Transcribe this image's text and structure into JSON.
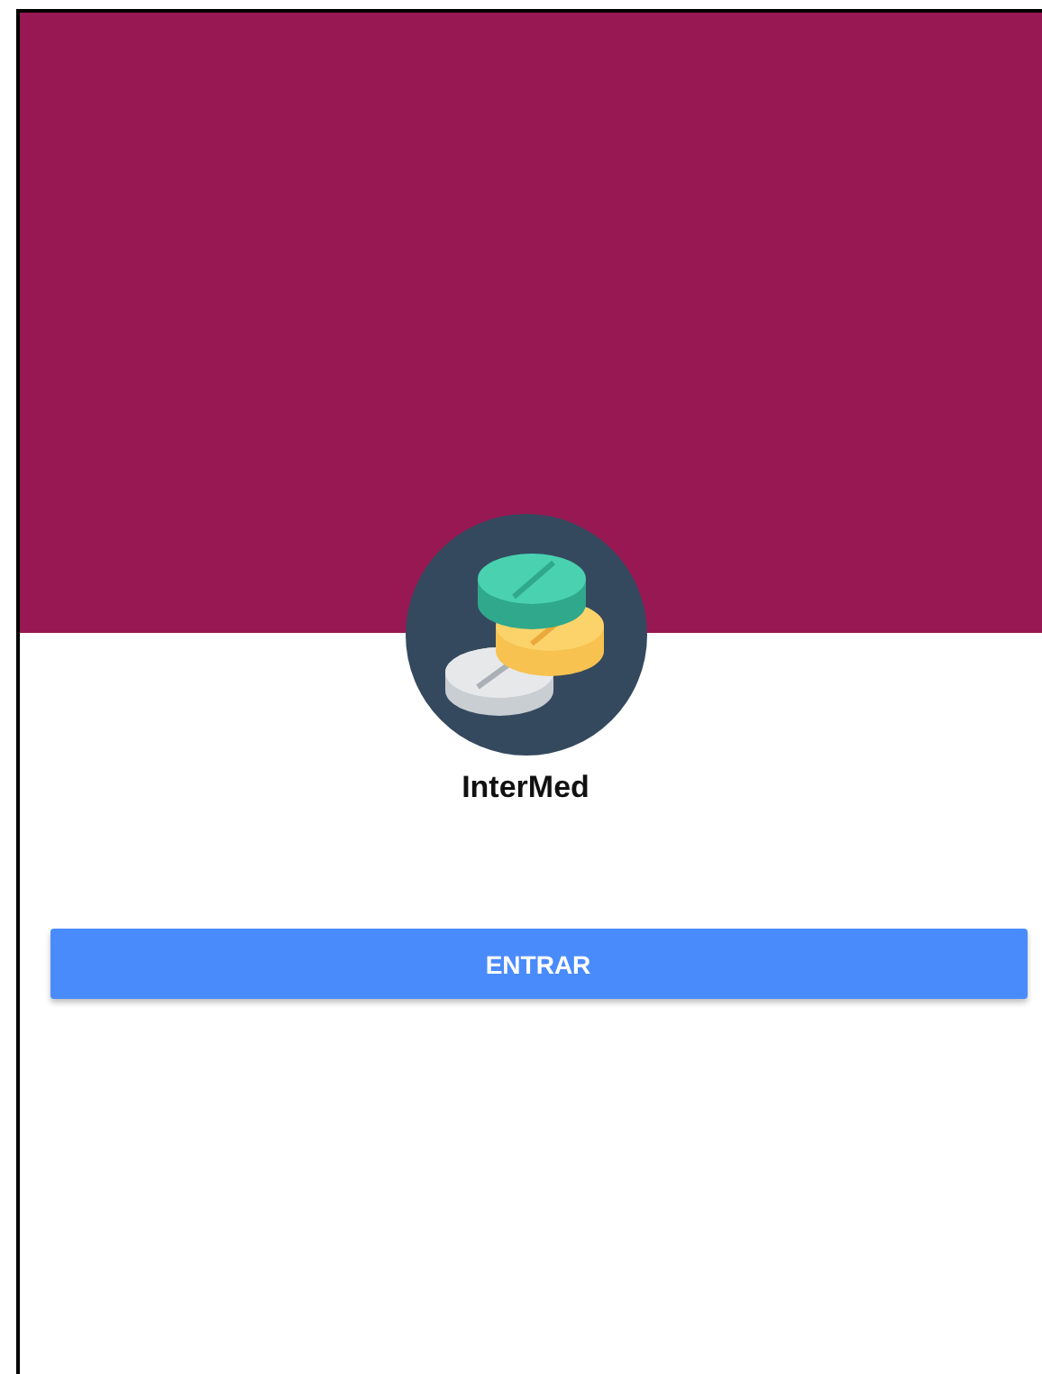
{
  "app": {
    "name": "InterMed"
  },
  "buttons": [
    {
      "label": "ENTRAR"
    }
  ]
}
